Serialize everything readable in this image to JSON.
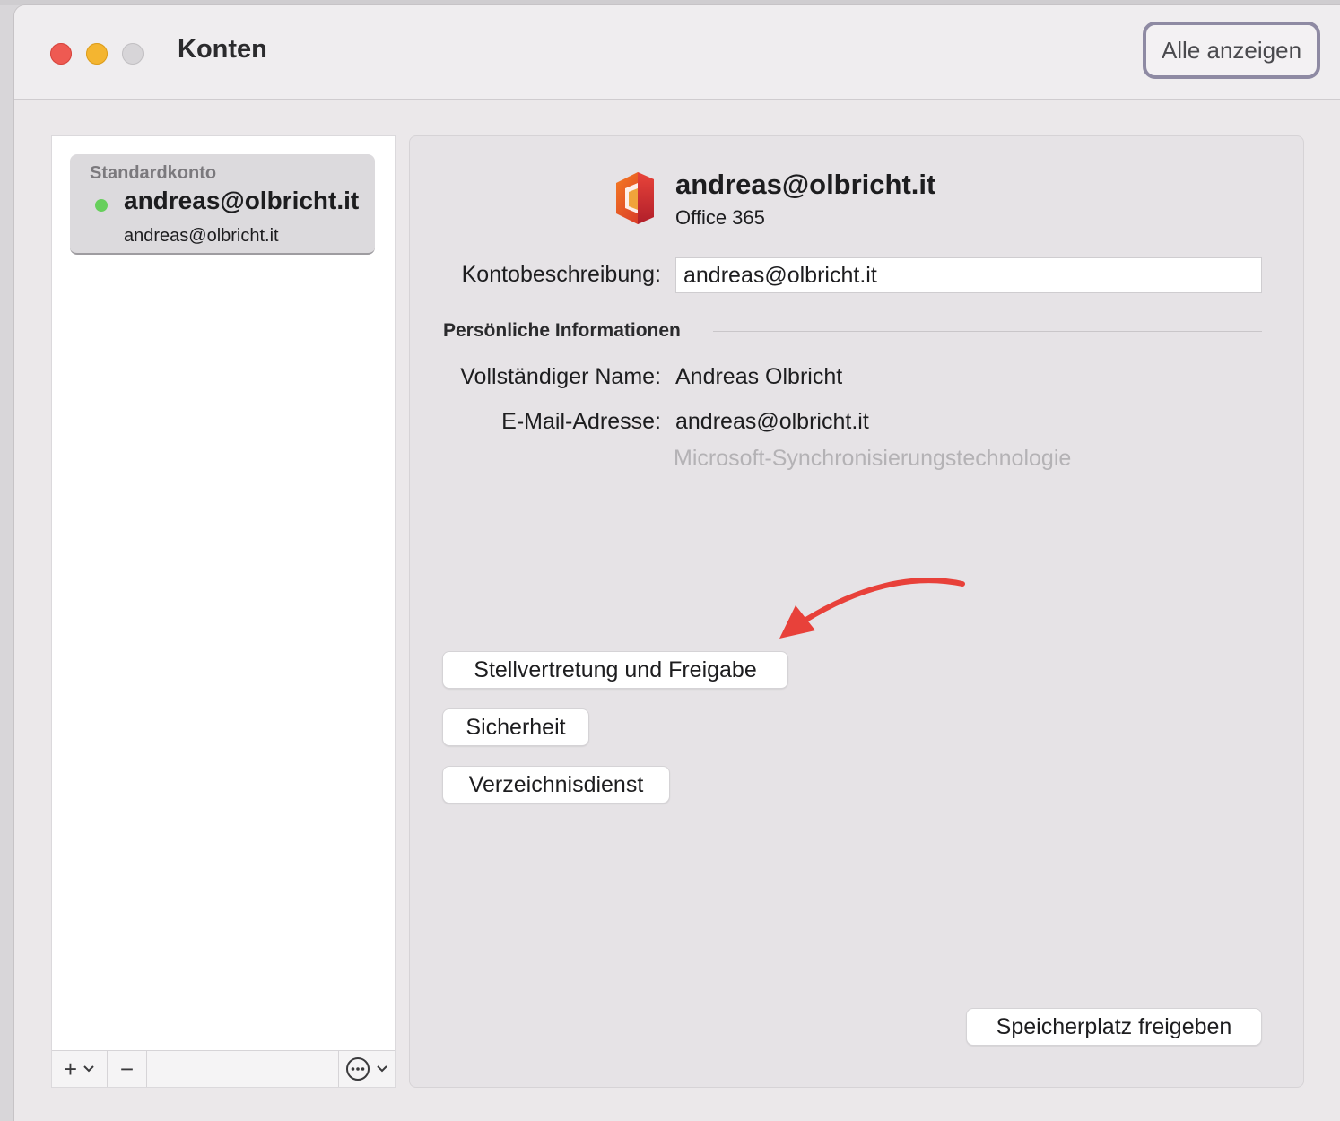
{
  "window": {
    "title": "Konten",
    "show_all_label": "Alle anzeigen"
  },
  "sidebar": {
    "section_label": "Standardkonto",
    "account": {
      "name": "andreas@olbricht.it",
      "subtitle": "andreas@olbricht.it",
      "status_color": "#67cf5c"
    },
    "toolbar": {
      "add_symbol": "+",
      "remove_symbol": "−",
      "more_symbol": "⊙",
      "chevron": "⌄"
    }
  },
  "account_detail": {
    "header_name": "andreas@olbricht.it",
    "account_type": "Office 365",
    "description_label": "Kontobeschreibung:",
    "description_value": "andreas@olbricht.it",
    "personal_section_title": "Persönliche Informationen",
    "full_name_label": "Vollständiger Name:",
    "full_name_value": "Andreas Olbricht",
    "email_label": "E-Mail-Adresse:",
    "email_value": "andreas@olbricht.it",
    "sync_technology": "Microsoft-Synchronisierungstechnologie"
  },
  "buttons": {
    "delegation": "Stellvertretung und Freigabe",
    "security": "Sicherheit",
    "directory": "Verzeichnisdienst",
    "free_storage": "Speicherplatz freigeben"
  },
  "colors": {
    "annotation_arrow": "#e8413a",
    "office_red": "#e33b2e"
  }
}
